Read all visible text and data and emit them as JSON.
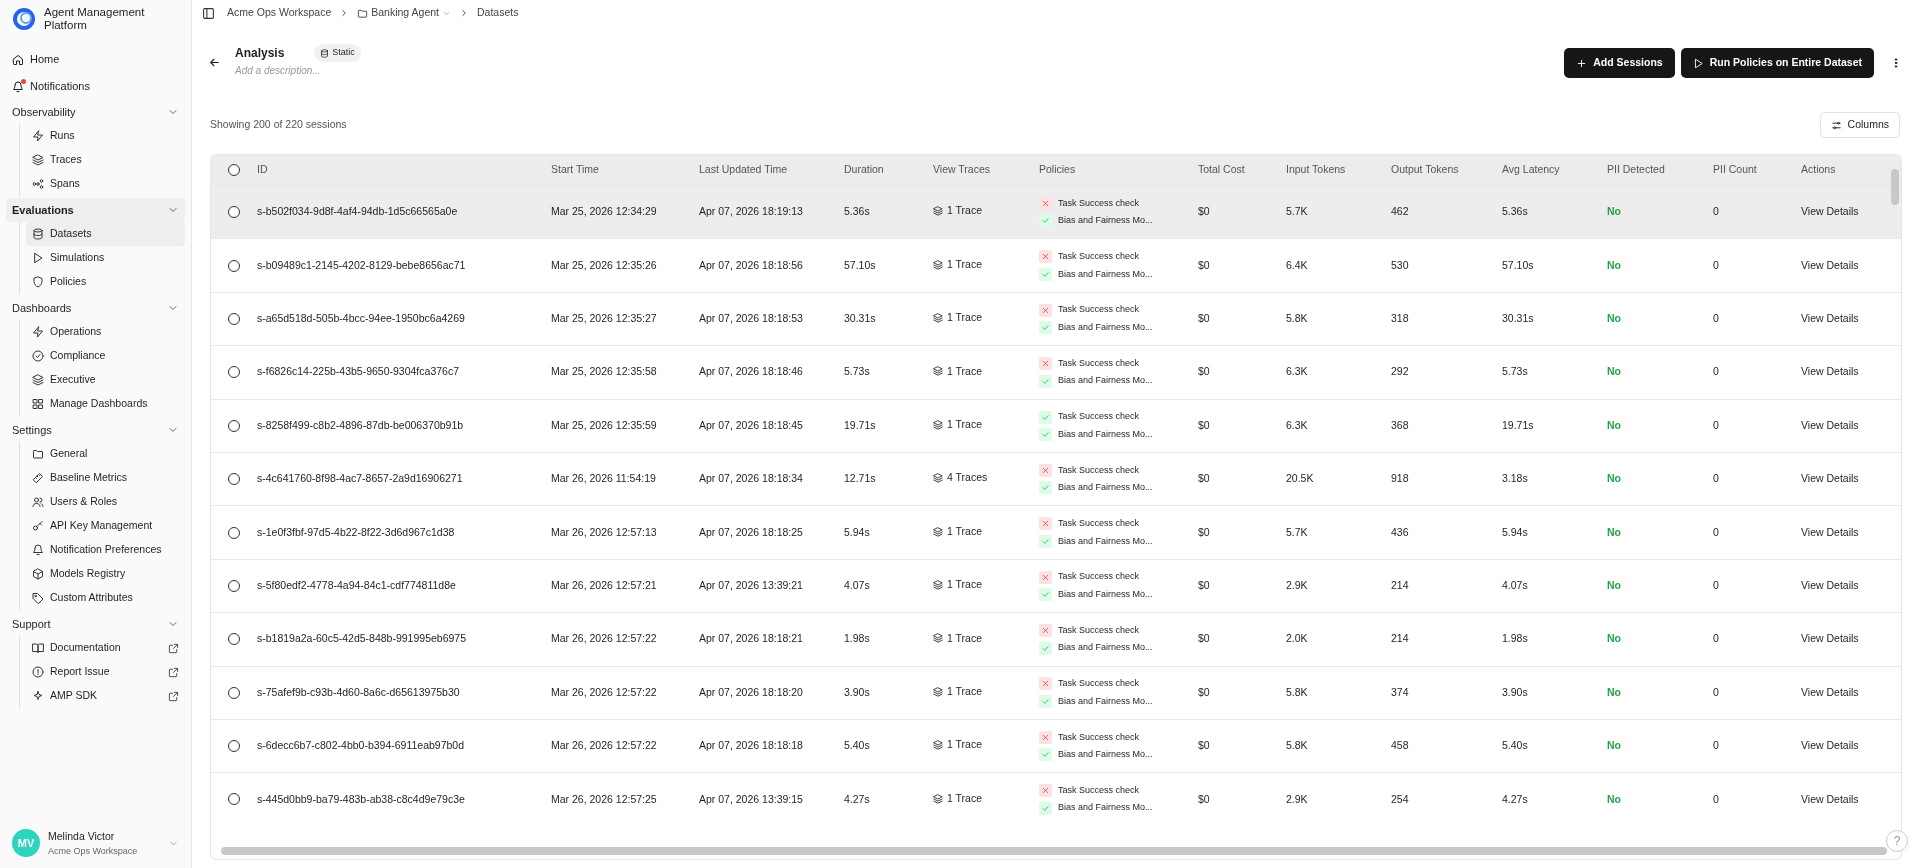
{
  "app": {
    "name": "Agent Management Platform"
  },
  "sidebar": {
    "top_items": [
      {
        "label": "Home",
        "selected": false,
        "unread_dot": false
      },
      {
        "label": "Notifications",
        "selected": false,
        "unread_dot": true
      }
    ],
    "sections": [
      {
        "title": "Observability",
        "expanded": true,
        "highlighted": false,
        "items": [
          {
            "label": "Runs",
            "selected": false,
            "external": false
          },
          {
            "label": "Traces",
            "selected": false,
            "external": false
          },
          {
            "label": "Spans",
            "selected": false,
            "external": false
          }
        ]
      },
      {
        "title": "Evaluations",
        "expanded": true,
        "highlighted": true,
        "items": [
          {
            "label": "Datasets",
            "selected": true,
            "external": false
          },
          {
            "label": "Simulations",
            "selected": false,
            "external": false
          },
          {
            "label": "Policies",
            "selected": false,
            "external": false
          }
        ]
      },
      {
        "title": "Dashboards",
        "expanded": true,
        "highlighted": false,
        "items": [
          {
            "label": "Operations",
            "selected": false,
            "external": false
          },
          {
            "label": "Compliance",
            "selected": false,
            "external": false
          },
          {
            "label": "Executive",
            "selected": false,
            "external": false
          },
          {
            "label": "Manage Dashboards",
            "selected": false,
            "external": false
          }
        ]
      },
      {
        "title": "Settings",
        "expanded": true,
        "highlighted": false,
        "items": [
          {
            "label": "General",
            "selected": false,
            "external": false
          },
          {
            "label": "Baseline Metrics",
            "selected": false,
            "external": false
          },
          {
            "label": "Users & Roles",
            "selected": false,
            "external": false
          },
          {
            "label": "API Key Management",
            "selected": false,
            "external": false
          },
          {
            "label": "Notification Preferences",
            "selected": false,
            "external": false
          },
          {
            "label": "Models Registry",
            "selected": false,
            "external": false
          },
          {
            "label": "Custom Attributes",
            "selected": false,
            "external": false
          }
        ]
      },
      {
        "title": "Support",
        "expanded": true,
        "highlighted": false,
        "items": [
          {
            "label": "Documentation",
            "selected": false,
            "external": true
          },
          {
            "label": "Report Issue",
            "selected": false,
            "external": true
          },
          {
            "label": "AMP SDK",
            "selected": false,
            "external": true
          }
        ]
      }
    ],
    "user": {
      "initials": "MV",
      "name": "Melinda Victor",
      "workspace": "Acme Ops Workspace"
    }
  },
  "breadcrumb": [
    "Acme Ops Workspace",
    "Banking Agent",
    "Datasets"
  ],
  "dataset": {
    "title": "Analysis",
    "badge": "Static",
    "description_placeholder": "Add a description..."
  },
  "buttons": [
    "Add Sessions",
    "Run Policies on Entire Dataset"
  ],
  "summary": "Showing 200 of 220 sessions",
  "columns_button": "Columns",
  "table": {
    "select_all": {
      "checked": false
    },
    "columns": [
      "ID",
      "Start Time",
      "Last Updated Time",
      "Duration",
      "View Traces",
      "Policies",
      "Total Cost",
      "Input Tokens",
      "Output Tokens",
      "Avg Latency",
      "PII Detected",
      "PII Count",
      "Actions"
    ],
    "rows": [
      {
        "highlighted": true,
        "checked": false,
        "id": "s-b502f034-9d8f-4af4-94db-1d5c66565a0e",
        "start": "Mar 25, 2026 12:34:29",
        "updated": "Apr 07, 2026 18:19:13",
        "duration": "5.36s",
        "traces": "1 Trace",
        "policies": [
          {
            "name": "Task Success check",
            "passed": false
          },
          {
            "name": "Bias and Fairness Mo...",
            "passed": true
          }
        ],
        "cost": "$0",
        "input": "5.7K",
        "output": "462",
        "latency": "5.36s",
        "pii": "No",
        "pii_count": "0",
        "action": "View Details"
      },
      {
        "highlighted": false,
        "checked": false,
        "id": "s-b09489c1-2145-4202-8129-bebe8656ac71",
        "start": "Mar 25, 2026 12:35:26",
        "updated": "Apr 07, 2026 18:18:56",
        "duration": "57.10s",
        "traces": "1 Trace",
        "policies": [
          {
            "name": "Task Success check",
            "passed": false
          },
          {
            "name": "Bias and Fairness Mo...",
            "passed": true
          }
        ],
        "cost": "$0",
        "input": "6.4K",
        "output": "530",
        "latency": "57.10s",
        "pii": "No",
        "pii_count": "0",
        "action": "View Details"
      },
      {
        "highlighted": false,
        "checked": false,
        "id": "s-a65d518d-505b-4bcc-94ee-1950bc6a4269",
        "start": "Mar 25, 2026 12:35:27",
        "updated": "Apr 07, 2026 18:18:53",
        "duration": "30.31s",
        "traces": "1 Trace",
        "policies": [
          {
            "name": "Task Success check",
            "passed": false
          },
          {
            "name": "Bias and Fairness Mo...",
            "passed": true
          }
        ],
        "cost": "$0",
        "input": "5.8K",
        "output": "318",
        "latency": "30.31s",
        "pii": "No",
        "pii_count": "0",
        "action": "View Details"
      },
      {
        "highlighted": false,
        "checked": false,
        "id": "s-f6826c14-225b-43b5-9650-9304fca376c7",
        "start": "Mar 25, 2026 12:35:58",
        "updated": "Apr 07, 2026 18:18:46",
        "duration": "5.73s",
        "traces": "1 Trace",
        "policies": [
          {
            "name": "Task Success check",
            "passed": false
          },
          {
            "name": "Bias and Fairness Mo...",
            "passed": true
          }
        ],
        "cost": "$0",
        "input": "6.3K",
        "output": "292",
        "latency": "5.73s",
        "pii": "No",
        "pii_count": "0",
        "action": "View Details"
      },
      {
        "highlighted": false,
        "checked": false,
        "id": "s-8258f499-c8b2-4896-87db-be006370b91b",
        "start": "Mar 25, 2026 12:35:59",
        "updated": "Apr 07, 2026 18:18:45",
        "duration": "19.71s",
        "traces": "1 Trace",
        "policies": [
          {
            "name": "Task Success check",
            "passed": true
          },
          {
            "name": "Bias and Fairness Mo...",
            "passed": true
          }
        ],
        "cost": "$0",
        "input": "6.3K",
        "output": "368",
        "latency": "19.71s",
        "pii": "No",
        "pii_count": "0",
        "action": "View Details"
      },
      {
        "highlighted": false,
        "checked": false,
        "id": "s-4c641760-8f98-4ac7-8657-2a9d16906271",
        "start": "Mar 26, 2026 11:54:19",
        "updated": "Apr 07, 2026 18:18:34",
        "duration": "12.71s",
        "traces": "4 Traces",
        "policies": [
          {
            "name": "Task Success check",
            "passed": false
          },
          {
            "name": "Bias and Fairness Mo...",
            "passed": true
          }
        ],
        "cost": "$0",
        "input": "20.5K",
        "output": "918",
        "latency": "3.18s",
        "pii": "No",
        "pii_count": "0",
        "action": "View Details"
      },
      {
        "highlighted": false,
        "checked": false,
        "id": "s-1e0f3fbf-97d5-4b22-8f22-3d6d967c1d38",
        "start": "Mar 26, 2026 12:57:13",
        "updated": "Apr 07, 2026 18:18:25",
        "duration": "5.94s",
        "traces": "1 Trace",
        "policies": [
          {
            "name": "Task Success check",
            "passed": false
          },
          {
            "name": "Bias and Fairness Mo...",
            "passed": true
          }
        ],
        "cost": "$0",
        "input": "5.7K",
        "output": "436",
        "latency": "5.94s",
        "pii": "No",
        "pii_count": "0",
        "action": "View Details"
      },
      {
        "highlighted": false,
        "checked": false,
        "id": "s-5f80edf2-4778-4a94-84c1-cdf774811d8e",
        "start": "Mar 26, 2026 12:57:21",
        "updated": "Apr 07, 2026 13:39:21",
        "duration": "4.07s",
        "traces": "1 Trace",
        "policies": [
          {
            "name": "Task Success check",
            "passed": false
          },
          {
            "name": "Bias and Fairness Mo...",
            "passed": true
          }
        ],
        "cost": "$0",
        "input": "2.9K",
        "output": "214",
        "latency": "4.07s",
        "pii": "No",
        "pii_count": "0",
        "action": "View Details"
      },
      {
        "highlighted": false,
        "checked": false,
        "id": "s-b1819a2a-60c5-42d5-848b-991995eb6975",
        "start": "Mar 26, 2026 12:57:22",
        "updated": "Apr 07, 2026 18:18:21",
        "duration": "1.98s",
        "traces": "1 Trace",
        "policies": [
          {
            "name": "Task Success check",
            "passed": false
          },
          {
            "name": "Bias and Fairness Mo...",
            "passed": true
          }
        ],
        "cost": "$0",
        "input": "2.0K",
        "output": "214",
        "latency": "1.98s",
        "pii": "No",
        "pii_count": "0",
        "action": "View Details"
      },
      {
        "highlighted": false,
        "checked": false,
        "id": "s-75afef9b-c93b-4d60-8a6c-d65613975b30",
        "start": "Mar 26, 2026 12:57:22",
        "updated": "Apr 07, 2026 18:18:20",
        "duration": "3.90s",
        "traces": "1 Trace",
        "policies": [
          {
            "name": "Task Success check",
            "passed": false
          },
          {
            "name": "Bias and Fairness Mo...",
            "passed": true
          }
        ],
        "cost": "$0",
        "input": "5.8K",
        "output": "374",
        "latency": "3.90s",
        "pii": "No",
        "pii_count": "0",
        "action": "View Details"
      },
      {
        "highlighted": false,
        "checked": false,
        "id": "s-6decc6b7-c802-4bb0-b394-6911eab97b0d",
        "start": "Mar 26, 2026 12:57:22",
        "updated": "Apr 07, 2026 18:18:18",
        "duration": "5.40s",
        "traces": "1 Trace",
        "policies": [
          {
            "name": "Task Success check",
            "passed": false
          },
          {
            "name": "Bias and Fairness Mo...",
            "passed": true
          }
        ],
        "cost": "$0",
        "input": "5.8K",
        "output": "458",
        "latency": "5.40s",
        "pii": "No",
        "pii_count": "0",
        "action": "View Details"
      },
      {
        "highlighted": false,
        "checked": false,
        "id": "s-445d0bb9-ba79-483b-ab38-c8c4d9e79c3e",
        "start": "Mar 26, 2026 12:57:25",
        "updated": "Apr 07, 2026 13:39:15",
        "duration": "4.27s",
        "traces": "1 Trace",
        "policies": [
          {
            "name": "Task Success check",
            "passed": false
          },
          {
            "name": "Bias and Fairness Mo...",
            "passed": true
          }
        ],
        "cost": "$0",
        "input": "2.9K",
        "output": "254",
        "latency": "4.27s",
        "pii": "No",
        "pii_count": "0",
        "action": "View Details"
      }
    ]
  },
  "help_button": "?"
}
